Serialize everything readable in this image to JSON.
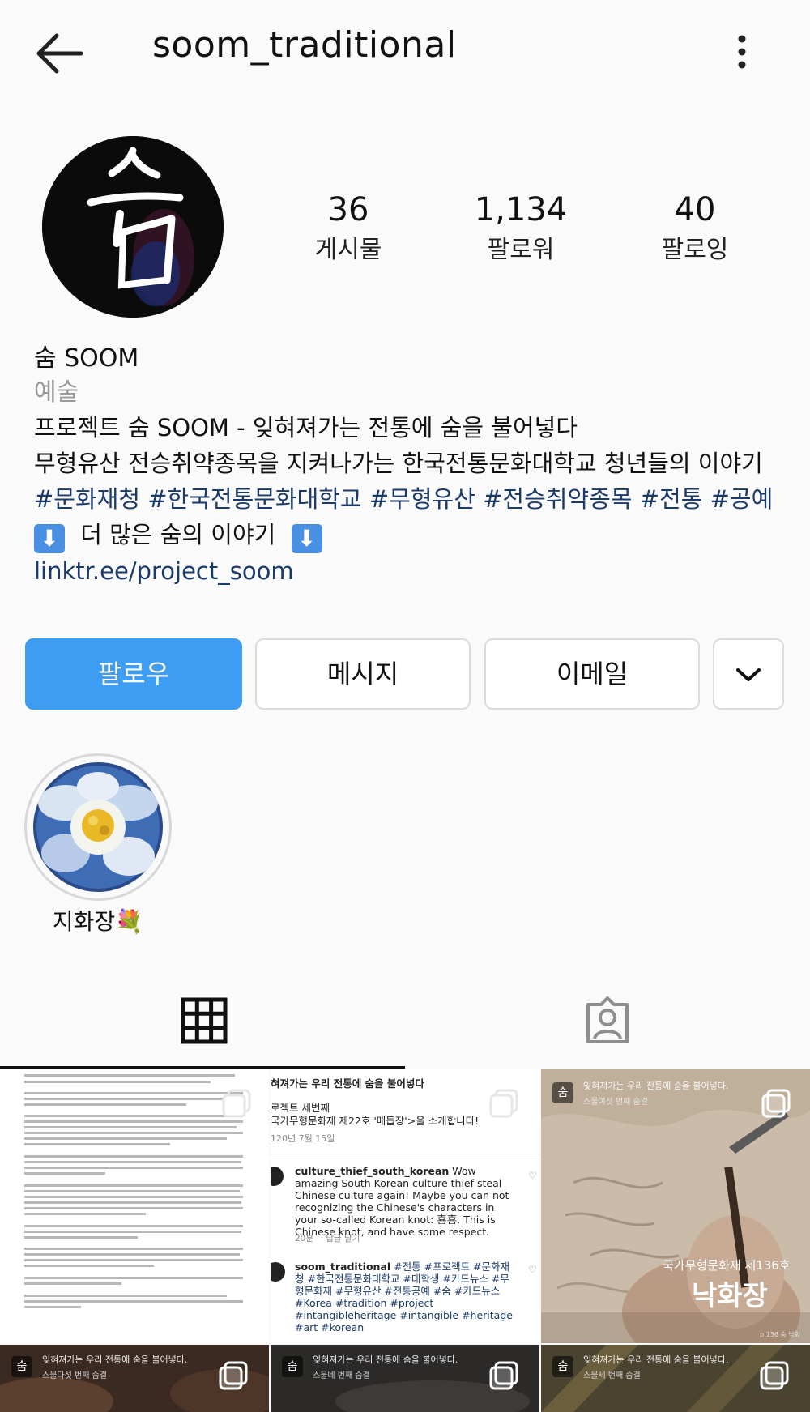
{
  "header": {
    "username": "soom_traditional",
    "back_icon": "arrow-left-icon",
    "more_icon": "more-vertical-icon"
  },
  "profile": {
    "avatar_glyph": "숨",
    "stats": [
      {
        "value": "36",
        "label": "게시물"
      },
      {
        "value": "1,134",
        "label": "팔로워"
      },
      {
        "value": "40",
        "label": "팔로잉"
      }
    ]
  },
  "bio": {
    "name": "숨 SOOM",
    "category": "예술",
    "line1": "프로젝트 숨 SOOM - 잊혀져가는 전통에 숨을 불어넣다",
    "line2": "무형유산 전승취약종목을 지켜나가는 한국전통문화대학교 청년들의 이야기",
    "hashtags": "#문화재청 #한국전통문화대학교 #무형유산 #전승취약종목 #전통 #공예",
    "more_prefix": "⬇",
    "more_text": "더 많은 숨의 이야기",
    "more_suffix": "⬇",
    "link": "linktr.ee/project_soom"
  },
  "actions": {
    "follow": "팔로우",
    "message": "메시지",
    "email": "이메일",
    "dropdown_icon": "chevron-down-icon"
  },
  "highlights": [
    {
      "label": "지화장💐"
    }
  ],
  "tabs": {
    "grid_icon": "grid-icon",
    "tagged_icon": "tagged-person-icon"
  },
  "posts": {
    "comments_post": {
      "header_line": "혀져가는 우리 전통에 숨을 불어넣다",
      "project_line": "로젝트 세번째",
      "title_line": "국가무형문화재 제22호 '매듭장'>을 소개합니다!",
      "date_line": "120년 7월 15일",
      "comment1_user": "culture_thief_south_korean",
      "comment1_text": " Wow amazing South Korean culture thief steal Chinese culture again! Maybe you can not recognizing the Chinese's characters in your so-called Korean knot: 喜喜. This is Chinese knot, and have some respect.",
      "comment1_time": "20분",
      "comment1_reply": "답글 달기",
      "comment2_user": "soom_traditional",
      "comment2_text": " #전통 #프로젝트 #문화재청 #한국전통문화대학교 #대학생 #카드뉴스 #무형문화재 #무형유산 #전통공예 #숨 #카드뉴스 #Korea #tradition #project #intangibleheritage #intangible #heritage #art #korean"
    },
    "paint_post": {
      "top_line": "잊혀져가는 우리 전통에 숨을 불어넣다.",
      "sub_line": "스물여섯 번째 숨결",
      "title": "국가무형문화재 제136호",
      "big_title": "낙화장",
      "foot": "p.136 숨 낙화"
    },
    "bottom_posts": [
      {
        "top_line": "잊혀져가는 우리 전통에 숨을 불어넣다.",
        "sub_line": "스물다섯 번째 숨결"
      },
      {
        "top_line": "잊혀져가는 우리 전통에 숨을 불어넣다.",
        "sub_line": "스물네 번째 숨결"
      },
      {
        "top_line": "잊혀져가는 우리 전통에 숨을 불어넣다.",
        "sub_line": "스물세 번째 숨결"
      }
    ]
  }
}
